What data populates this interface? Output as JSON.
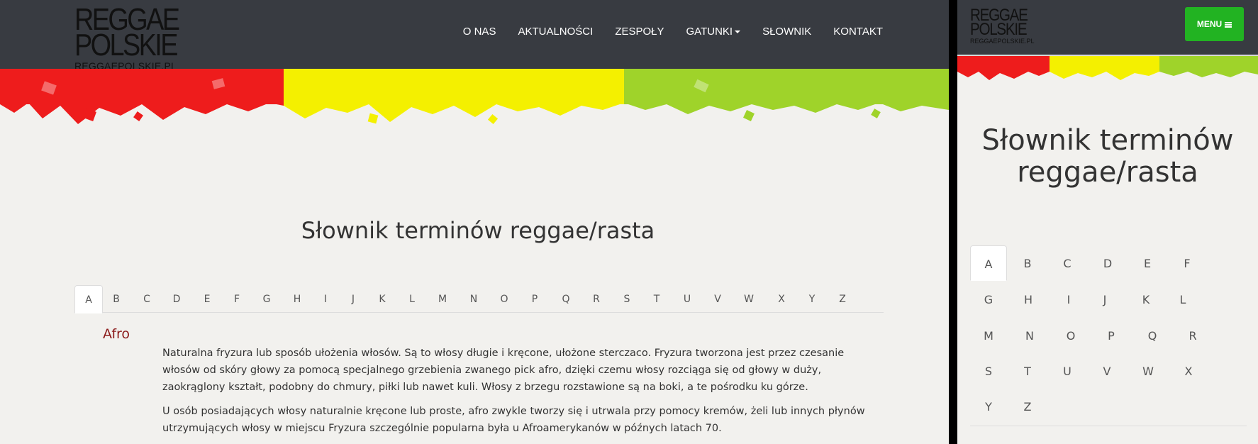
{
  "logo": {
    "line1": "REGGAE",
    "line2": "POLSKIE",
    "url": "REGGAEPOLSKIE.PL"
  },
  "nav": {
    "items": [
      "O NAS",
      "AKTUALNOŚCI",
      "ZESPOŁY",
      "GATUNKI",
      "SŁOWNIK",
      "KONTAKT"
    ]
  },
  "colors": {
    "header_bg": "#383b41",
    "page_bg": "#f2f1ee",
    "term": "#8b1a1a",
    "menu_button": "#22b322",
    "splash_red": "#ee1c1c",
    "splash_yellow": "#f4f000",
    "splash_green": "#9fd32a"
  },
  "page": {
    "title": "Słownik terminów reggae/rasta"
  },
  "letters": [
    "A",
    "B",
    "C",
    "D",
    "E",
    "F",
    "G",
    "H",
    "I",
    "J",
    "K",
    "L",
    "M",
    "N",
    "O",
    "P",
    "Q",
    "R",
    "S",
    "T",
    "U",
    "V",
    "W",
    "X",
    "Y",
    "Z"
  ],
  "active_letter": "A",
  "entry": {
    "term": "Afro",
    "paragraphs": [
      "Naturalna fryzura lub sposób ułożenia włosów. Są to włosy długie i kręcone, ułożone sterczaco.  Fryzura tworzona jest przez czesanie włosów od skóry głowy za pomocą specjalnego grzebienia zwanego pick afro, dzięki czemu włosy rozciąga się od głowy w duży, zaokrąglony kształt, podobny do chmury, piłki lub nawet kuli. Włosy z brzegu rozstawione są na boki, a te pośrodku ku górze.",
      "U osób posiadających włosy naturalnie kręcone lub proste, afro zwykle tworzy się i utrwala przy pomocy kremów, żeli lub innych płynów utrzymujących włosy w miejscu Fryzura szczególnie popularna była u Afroamerykanów w późnych latach 70."
    ]
  },
  "mobile": {
    "title_line1": "Słownik terminów",
    "title_line2": "reggae/rasta",
    "menu_label": "MENU"
  },
  "icons": {
    "menu": "hamburger-icon",
    "dropdown": "caret-down-icon"
  }
}
